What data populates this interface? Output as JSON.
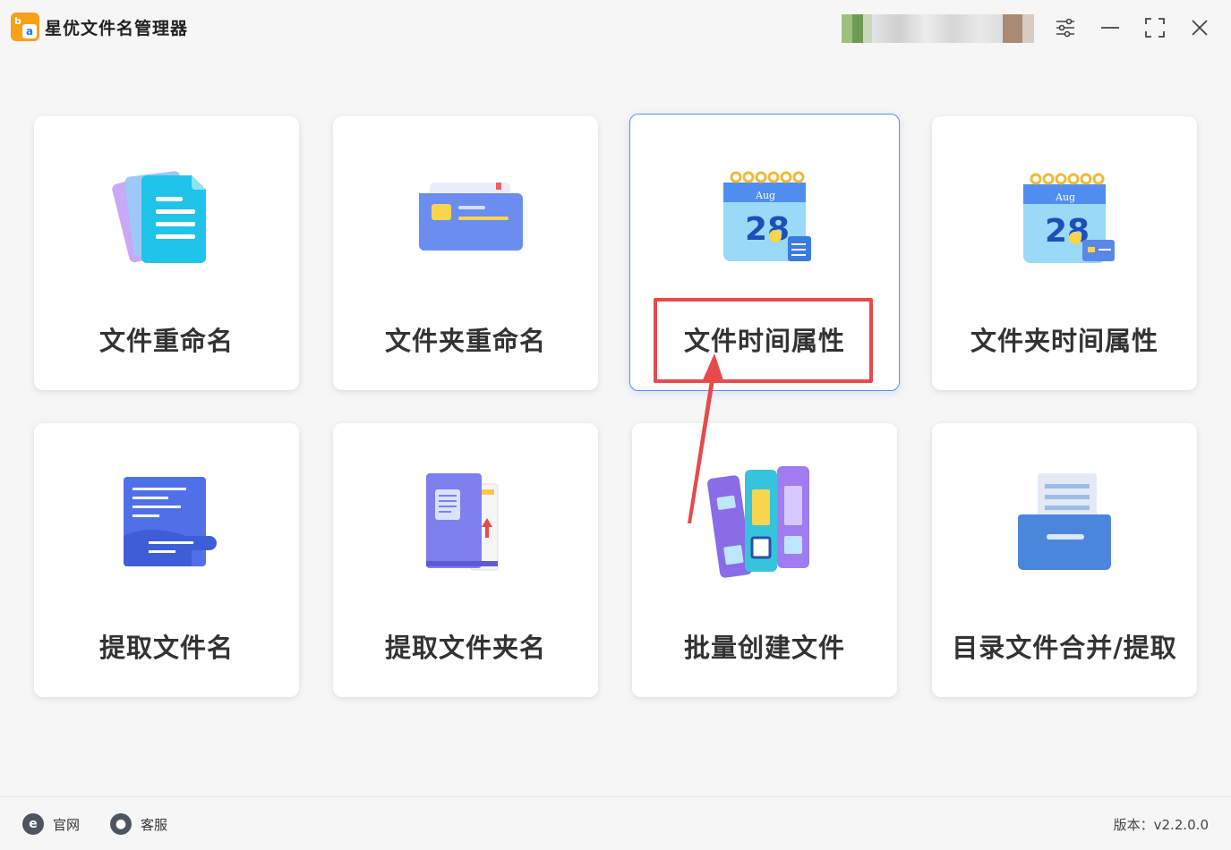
{
  "app": {
    "title": "星优文件名管理器",
    "logo_letters": {
      "top": "b",
      "bottom": "a"
    }
  },
  "titlebar": {
    "icons": [
      "settings-sliders-icon",
      "minimize-icon",
      "maximize-icon",
      "close-icon"
    ]
  },
  "cards": [
    {
      "label": "文件重命名",
      "icon": "document-icon"
    },
    {
      "label": "文件夹重命名",
      "icon": "folder-icon"
    },
    {
      "label": "文件时间属性",
      "icon": "calendar-document-icon",
      "selected": true
    },
    {
      "label": "文件夹时间属性",
      "icon": "calendar-folder-icon"
    },
    {
      "label": "提取文件名",
      "icon": "scroll-icon"
    },
    {
      "label": "提取文件夹名",
      "icon": "book-folder-icon"
    },
    {
      "label": "批量创建文件",
      "icon": "binders-icon"
    },
    {
      "label": "目录文件合并/提取",
      "icon": "drawer-folder-icon"
    }
  ],
  "calendar": {
    "month": "Aug",
    "day": "28"
  },
  "footer": {
    "website_label": "官网",
    "support_label": "客服",
    "version": "版本：v2.2.0.0"
  },
  "colors": {
    "accent": "#5b8ef7",
    "highlight": "#e8494a",
    "logo": "#f7a11a"
  }
}
